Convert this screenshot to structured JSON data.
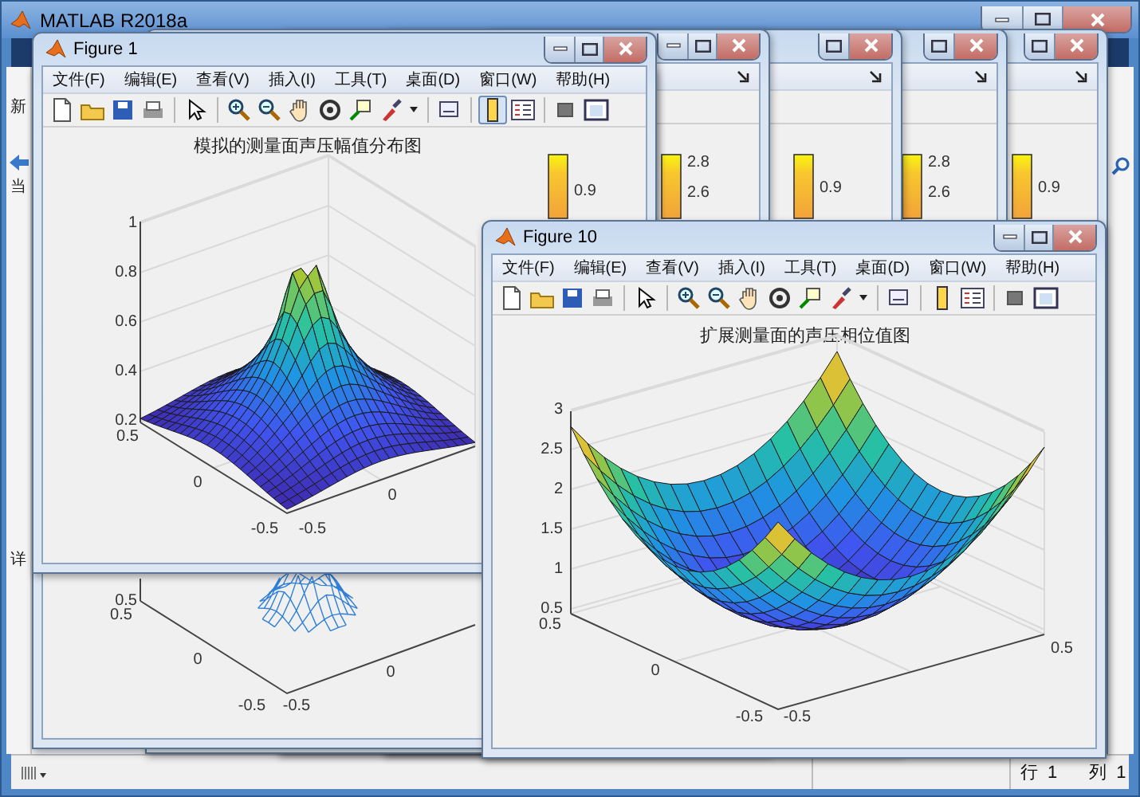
{
  "main_window": {
    "title": "MATLAB R2018a",
    "side_labels": [
      "新",
      "当",
      "详"
    ],
    "status_bar": {
      "row_label": "行",
      "row": "1",
      "column_label": "列",
      "column": "1"
    }
  },
  "background_figures": [
    {
      "colorbar_ticks": [
        "2.8",
        "2.6"
      ]
    },
    {
      "colorbar_ticks": [
        "0.9"
      ]
    },
    {
      "colorbar_ticks": [
        "2.8",
        "2.6"
      ]
    },
    {
      "colorbar_ticks": [
        "0.9"
      ]
    }
  ],
  "mesh_figure": {
    "z_ticks": [
      "0.5"
    ],
    "y_ticks": [
      "0.5",
      "0",
      "-0.5"
    ],
    "x_ticks": [
      "-0.5",
      "0"
    ]
  },
  "figures": [
    {
      "title": "Figure 1",
      "menus": [
        "文件(F)",
        "编辑(E)",
        "查看(V)",
        "插入(I)",
        "工具(T)",
        "桌面(D)",
        "窗口(W)",
        "帮助(H)"
      ],
      "colorbar_button_pressed": true,
      "plot_title": "模拟的测量面声压幅值分布图",
      "colorbar_ticks": [
        "0.9"
      ],
      "z_ticks": [
        "1",
        "0.8",
        "0.6",
        "0.4",
        "0.2"
      ],
      "y_ticks": [
        "0.5",
        "0",
        "-0.5"
      ],
      "x_ticks": [
        "-0.5",
        "0"
      ]
    },
    {
      "title": "Figure 10",
      "menus": [
        "文件(F)",
        "编辑(E)",
        "查看(V)",
        "插入(I)",
        "工具(T)",
        "桌面(D)",
        "窗口(W)",
        "帮助(H)"
      ],
      "colorbar_button_pressed": false,
      "plot_title": "扩展测量面的声压相位值图",
      "z_ticks": [
        "3",
        "2.5",
        "2",
        "1.5",
        "1",
        "0.5"
      ],
      "y_ticks": [
        "0.5",
        "0",
        "-0.5"
      ],
      "x_ticks": [
        "-0.5",
        "0.5"
      ]
    }
  ]
}
